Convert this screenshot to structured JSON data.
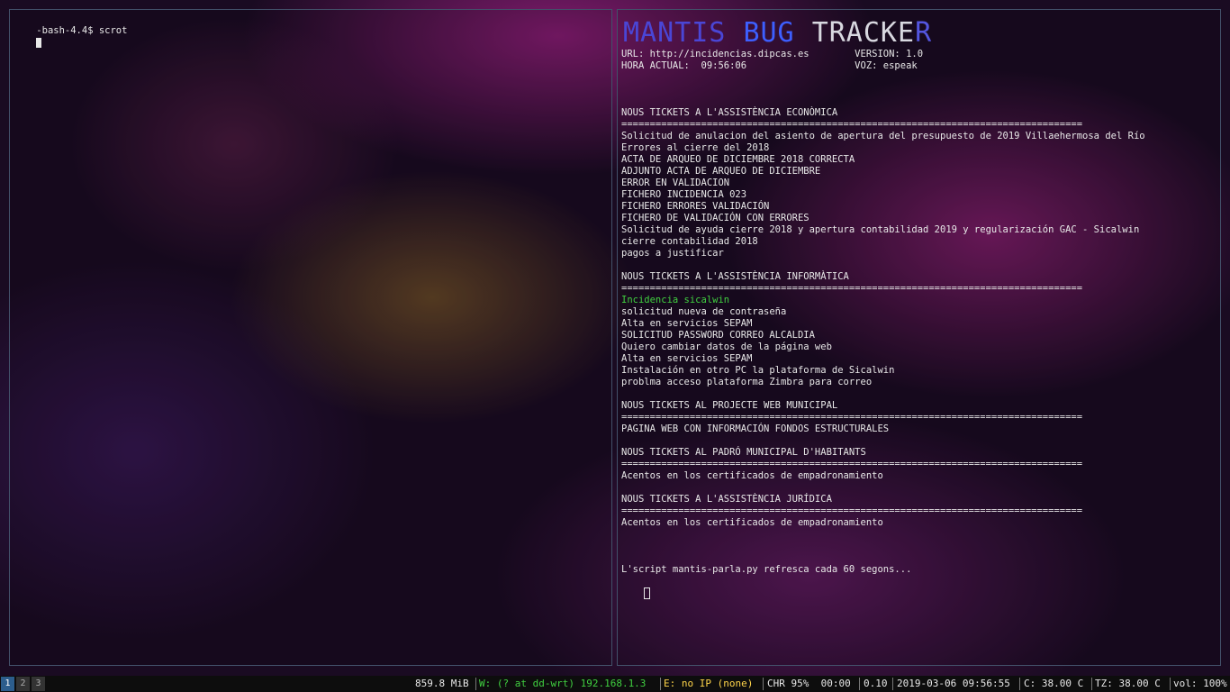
{
  "left_terminal": {
    "prompt_line": "-bash-4.4$ scrot"
  },
  "right_terminal": {
    "logo": [
      "MANTIS",
      "BUG",
      "TRACKE",
      "R"
    ],
    "url_line": "URL: http://incidencias.dipcas.es        VERSION: 1.0",
    "hora_line": "HORA ACTUAL:  09:56:06                   VOZ: espeak",
    "separator": "=================================================================================",
    "sections": [
      {
        "title": "NOUS TICKETS A L'ASSISTÈNCIA ECONÒMICA",
        "tickets": [
          "Solicitud de anulacion del asiento de apertura del presupuesto de 2019 Villaehermosa del Río",
          "Errores al cierre del 2018",
          "ACTA DE ARQUEO DE DICIEMBRE 2018 CORRECTA",
          "ADJUNTO ACTA DE ARQUEO DE DICIEMBRE",
          "ERROR EN VALIDACION",
          "FICHERO INCIDENCIA 023",
          "FICHERO ERRORES VALIDACIÓN",
          "FICHERO DE VALIDACIÓN CON ERRORES",
          "Solicitud de ayuda cierre 2018 y apertura contabilidad 2019 y regularización GAC - Sicalwin",
          "cierre contabilidad 2018",
          "pagos a justificar"
        ]
      },
      {
        "title": "NOUS TICKETS A L'ASSISTÈNCIA INFORMÀTICA",
        "highlighted": "Incidencia sicalwin",
        "tickets": [
          "solicitud nueva de contraseña",
          "Alta en servicios SEPAM",
          "SOLICITUD PASSWORD CORREO ALCALDIA",
          "Quiero cambiar datos de la página web",
          "Alta en servicios SEPAM",
          "Instalación en otro PC la plataforma de Sicalwin",
          "problma acceso plataforma Zimbra para correo"
        ]
      },
      {
        "title": "NOUS TICKETS AL PROJECTE WEB MUNICIPAL",
        "tickets": [
          "PAGINA WEB CON INFORMACIÓN FONDOS ESTRUCTURALES"
        ]
      },
      {
        "title": "NOUS TICKETS AL PADRÓ MUNICIPAL D'HABITANTS",
        "tickets": [
          "Acentos en los certificados de empadronamiento"
        ]
      },
      {
        "title": "NOUS TICKETS A L'ASSISTÈNCIA JURÍDICA",
        "tickets": [
          "Acentos en los certificados de empadronamiento"
        ]
      }
    ],
    "footer": "L'script mantis-parla.py refresca cada 60 segons..."
  },
  "statusbar": {
    "workspaces": [
      "1",
      "2",
      "3"
    ],
    "memory": "859.8 MiB",
    "wifi": "W: (? at dd-wrt) 192.168.1.3",
    "ethernet": "E: no IP (none)",
    "battery": "CHR 95%  00:00",
    "load": "0.10",
    "datetime": "2019-03-06 09:56:55",
    "cpu_temp": "C: 38.00 C",
    "tz_temp": "TZ: 38.00 C",
    "volume": "vol: 100%",
    "colors": {
      "wifi": "#40d040",
      "ethernet": "#ffd54a",
      "active_workspace": "#2c5d8c"
    }
  }
}
